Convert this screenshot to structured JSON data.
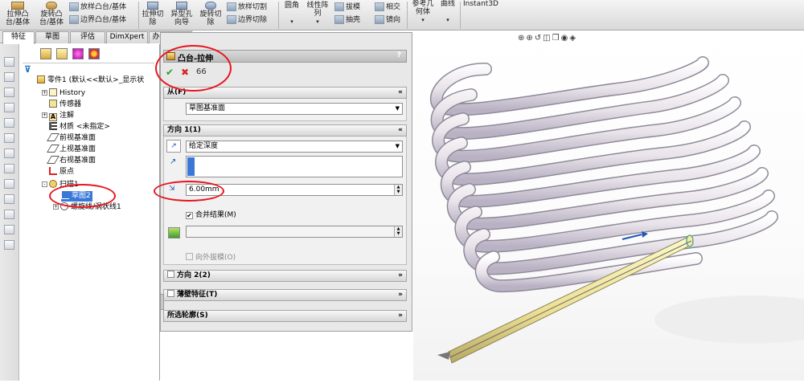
{
  "ribbon": {
    "items": [
      {
        "label": "拉伸凸\n台/基体",
        "icon": "extrude-boss-icon"
      },
      {
        "label": "旋转凸\n台/基体",
        "icon": "revolve-boss-icon"
      },
      {
        "label": "放样凸台/基体",
        "icon": "loft-boss-icon"
      },
      {
        "label": "边界凸台/基体",
        "icon": "boundary-boss-icon"
      },
      {
        "label": "拉伸切\n除",
        "icon": "extrude-cut-icon"
      },
      {
        "label": "异型孔\n向导",
        "icon": "hole-wizard-icon"
      },
      {
        "label": "旋转切\n除",
        "icon": "revolve-cut-icon"
      },
      {
        "label": "放样切割",
        "icon": "loft-cut-icon"
      },
      {
        "label": "边界切除",
        "icon": "boundary-cut-icon"
      },
      {
        "label": "圆角",
        "icon": "fillet-icon"
      },
      {
        "label": "线性阵\n列",
        "icon": "linear-pattern-icon"
      },
      {
        "label": "拔模",
        "icon": "draft-icon"
      },
      {
        "label": "抽壳",
        "icon": "shell-icon"
      },
      {
        "label": "相交",
        "icon": "intersect-icon"
      },
      {
        "label": "镜向",
        "icon": "mirror-icon"
      },
      {
        "label": "参考几\n何体",
        "icon": "reference-geometry-icon"
      },
      {
        "label": "曲线",
        "icon": "curves-icon"
      },
      {
        "label": "Instant3D",
        "icon": "instant3d-icon"
      }
    ]
  },
  "tabs": [
    "特征",
    "草图",
    "评估",
    "DimXpert",
    "办公室产品"
  ],
  "tree": {
    "part": "零件1  (默认<<默认>_显示状",
    "items": [
      {
        "label": "History",
        "icon": "history-icon",
        "expander": "+"
      },
      {
        "label": "传感器",
        "icon": "sensor-icon",
        "expander": ""
      },
      {
        "label": "注解",
        "icon": "annotation-icon",
        "expander": "+"
      },
      {
        "label": "材质 <未指定>",
        "icon": "material-icon",
        "expander": ""
      },
      {
        "label": "前视基准面",
        "icon": "plane-icon",
        "expander": ""
      },
      {
        "label": "上视基准面",
        "icon": "plane-icon",
        "expander": ""
      },
      {
        "label": "右视基准面",
        "icon": "plane-icon",
        "expander": ""
      },
      {
        "label": "原点",
        "icon": "origin-icon",
        "expander": ""
      },
      {
        "label": "扫描1",
        "icon": "sweep-icon",
        "expander": "-"
      },
      {
        "label": "草图2",
        "icon": "sketch-icon",
        "expander": ""
      },
      {
        "label": "螺旋线/涡状线1",
        "icon": "helix-icon",
        "expander": "+"
      }
    ]
  },
  "property_manager": {
    "title": "凸台-拉伸",
    "help": "?",
    "ok": "✔",
    "cancel": "✖",
    "preview": "66",
    "from": {
      "header": "从(F)",
      "value": "草图基准面"
    },
    "dir1": {
      "header": "方向 1(1)",
      "end_condition": "给定深度",
      "depth": "6.00mm",
      "merge_label": "合并结果(M)",
      "merge_checked": "✔",
      "draft_label": "向外拔模(O)"
    },
    "dir2": {
      "header": "方向 2(2)"
    },
    "thin": {
      "header": "薄壁特征(T)"
    },
    "contours": {
      "header": "所选轮廓(S)"
    }
  },
  "colors": {
    "highlight": "#3a78d8",
    "annotation": "#e8141f",
    "accent_green": "#2aa02a",
    "accent_red": "#d22a2a"
  }
}
